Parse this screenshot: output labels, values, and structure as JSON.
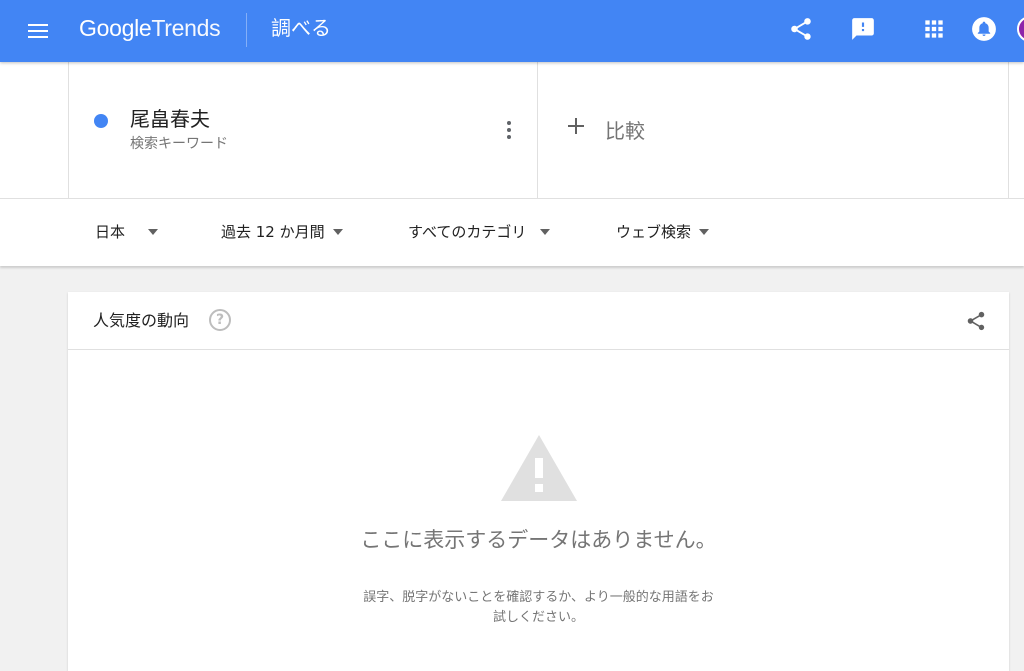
{
  "header": {
    "logo_google": "Google",
    "logo_trends": "Trends",
    "page_title": "調べる",
    "icons": [
      "menu-icon",
      "share-icon",
      "feedback-icon",
      "apps-icon",
      "notifications-icon",
      "avatar"
    ]
  },
  "search": {
    "term": "尾畠春夫",
    "term_type": "検索キーワード",
    "term_color": "#4285f4",
    "compare_label": "比較"
  },
  "filters": {
    "region": "日本",
    "period": "過去 12 か月間",
    "category": "すべてのカテゴリ",
    "search_type": "ウェブ検索"
  },
  "interest_card": {
    "title": "人気度の動向",
    "help_glyph": "?",
    "empty_title": "ここに表示するデータはありません。",
    "empty_desc": "誤字、脱字がないことを確認するか、より一般的な用語をお試しください。"
  },
  "colors": {
    "brand": "#4285f4",
    "background": "#f1f1f1",
    "warning_icon": "#e0e0e0"
  }
}
